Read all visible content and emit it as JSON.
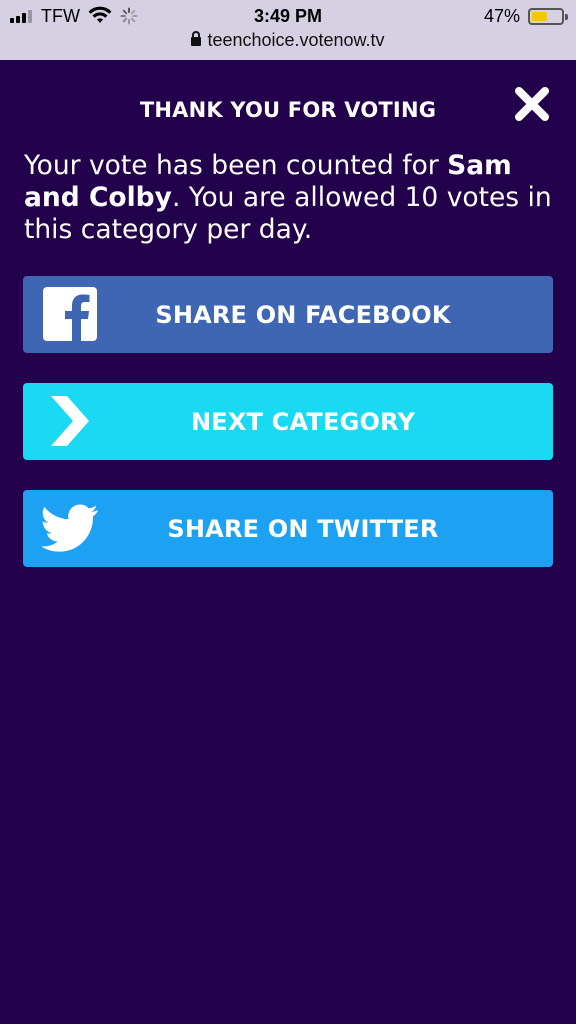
{
  "status_bar": {
    "carrier": "TFW",
    "time": "3:49 PM",
    "battery": "47%",
    "battery_level": 0.47,
    "battery_color": "#f7c600"
  },
  "url_bar": {
    "url": "teenchoice.votenow.tv",
    "icon": "lock-icon"
  },
  "modal": {
    "title": "THANK YOU FOR VOTING",
    "close_icon": "close-icon",
    "message_prefix": "Your vote has been counted for ",
    "nominee": "Sam and Colby",
    "message_suffix": ". You are allowed 10 votes in this category per day."
  },
  "buttons": [
    {
      "label": "SHARE ON FACEBOOK",
      "icon": "facebook-icon",
      "color": "#3f66b3"
    },
    {
      "label": "NEXT CATEGORY",
      "icon": "chevron-right-icon",
      "color": "#1ad9f2"
    },
    {
      "label": "SHARE ON TWITTER",
      "icon": "twitter-icon",
      "color": "#1da1f2"
    }
  ],
  "colors": {
    "background": "#22004c",
    "text": "#ffffff"
  }
}
